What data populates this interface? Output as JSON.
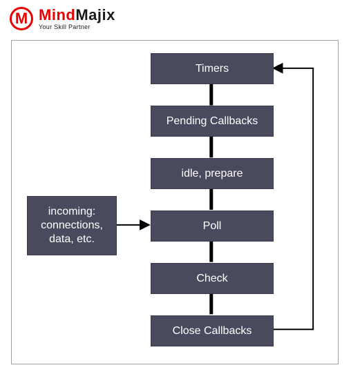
{
  "logo": {
    "name_red": "Mind",
    "name_dark": "Majix",
    "tagline": "Your Skill Partner",
    "mark_letter": "M"
  },
  "diagram": {
    "phases": {
      "timers": "Timers",
      "pending": "Pending Callbacks",
      "idle": "idle, prepare",
      "poll": "Poll",
      "check": "Check",
      "close": "Close Callbacks"
    },
    "incoming": "incoming:\nconnections,\ndata, etc."
  },
  "colors": {
    "box_fill": "#4a4a5e",
    "box_text": "#ffffff",
    "accent": "#e60000",
    "frame_border": "#9aa0a6",
    "connector": "#000000"
  }
}
